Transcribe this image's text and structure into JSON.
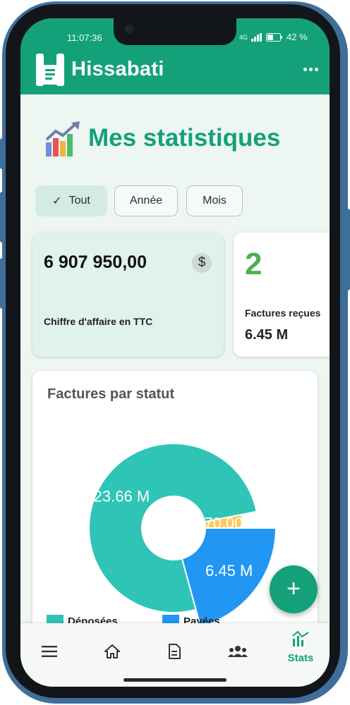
{
  "status_bar": {
    "time": "11:07:36",
    "network": "4G",
    "battery": "42 %"
  },
  "app_bar": {
    "title": "Hissabati",
    "logo_letter": "H"
  },
  "page": {
    "title": "Mes statistiques"
  },
  "filters": [
    {
      "label": "Tout",
      "selected": true
    },
    {
      "label": "Année",
      "selected": false
    },
    {
      "label": "Mois",
      "selected": false
    }
  ],
  "cards": [
    {
      "amount": "6 907 950,00",
      "label": "Chiffre d'affaire en TTC",
      "icon": "dollar-icon"
    },
    {
      "count": "2",
      "label": "Factures reçues",
      "value": "6.45 M"
    }
  ],
  "chart_card": {
    "title": "Factures par statut"
  },
  "chart_data": {
    "type": "pie",
    "title": "Factures par statut",
    "labels": [
      "Payées",
      "Déposées",
      ""
    ],
    "values": [
      6.45,
      23.66,
      0.97
    ],
    "data_labels": [
      "6.45 M",
      "23.66 M",
      "970.00 K"
    ],
    "colors": [
      "#2196f3",
      "#2ec4b6",
      "#ffc857"
    ],
    "legend": [
      {
        "name": "Déposées",
        "color": "#2ec4b6"
      },
      {
        "name": "Payées",
        "color": "#2196f3"
      }
    ],
    "legend_position": "bottom"
  },
  "fab": {
    "label": "+"
  },
  "bottom_nav": {
    "items": [
      {
        "icon": "menu-icon"
      },
      {
        "icon": "home-icon"
      },
      {
        "icon": "document-icon"
      },
      {
        "icon": "users-icon"
      },
      {
        "icon": "stats-icon",
        "label": "Stats",
        "active": true
      }
    ]
  }
}
